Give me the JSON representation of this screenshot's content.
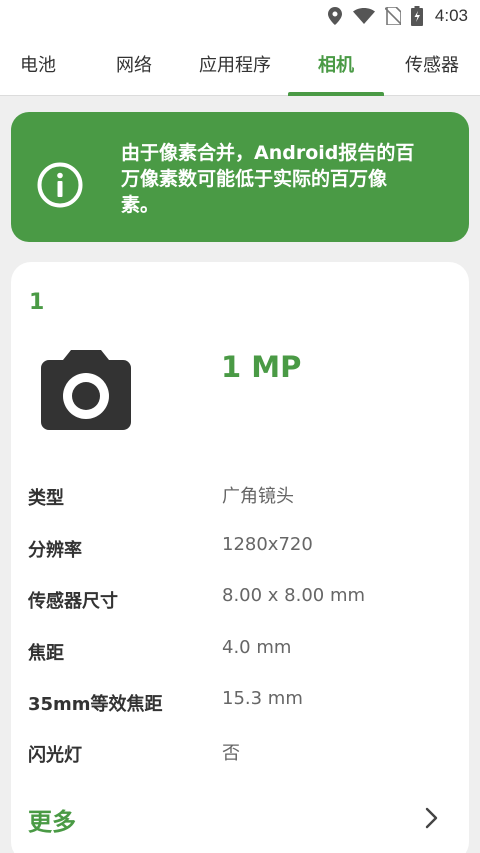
{
  "status_bar": {
    "time": "4:03",
    "icons": [
      "location-icon",
      "wifi-icon",
      "no-sim-icon",
      "battery-charging-icon"
    ]
  },
  "tabs": [
    {
      "label": "电池",
      "active": false
    },
    {
      "label": "网络",
      "active": false
    },
    {
      "label": "应用程序",
      "active": false
    },
    {
      "label": "相机",
      "active": true
    },
    {
      "label": "传感器",
      "active": false
    }
  ],
  "banner": {
    "icon": "info-icon",
    "text": "由于像素合并，Android报告的百万像素数可能低于实际的百万像素。"
  },
  "camera": {
    "index": "1",
    "icon": "camera-icon",
    "megapixels": "1 MP",
    "specs": [
      {
        "label": "类型",
        "value": "广角镜头"
      },
      {
        "label": "分辨率",
        "value": "1280x720"
      },
      {
        "label": "传感器尺寸",
        "value": "8.00 x 8.00 mm"
      },
      {
        "label": "焦距",
        "value": "4.0 mm"
      },
      {
        "label": "35mm等效焦距",
        "value": "15.3 mm"
      },
      {
        "label": "闪光灯",
        "value": "否"
      }
    ],
    "more_label": "更多"
  },
  "colors": {
    "accent": "#4a9a45",
    "background": "#efefef",
    "card": "#ffffff",
    "icon_dark": "#333333"
  }
}
